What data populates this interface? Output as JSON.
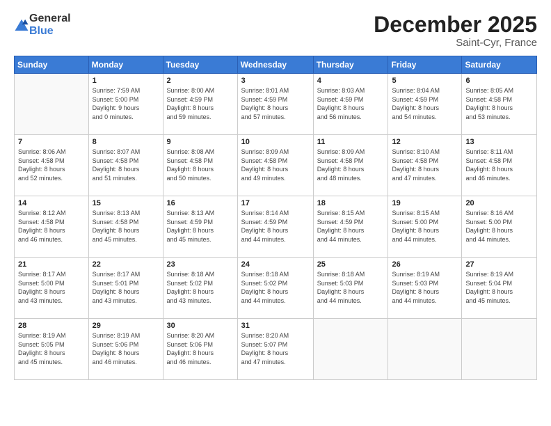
{
  "header": {
    "logo_general": "General",
    "logo_blue": "Blue",
    "title": "December 2025",
    "subtitle": "Saint-Cyr, France"
  },
  "calendar": {
    "days_of_week": [
      "Sunday",
      "Monday",
      "Tuesday",
      "Wednesday",
      "Thursday",
      "Friday",
      "Saturday"
    ],
    "weeks": [
      [
        {
          "day": "",
          "info": ""
        },
        {
          "day": "1",
          "info": "Sunrise: 7:59 AM\nSunset: 5:00 PM\nDaylight: 9 hours\nand 0 minutes."
        },
        {
          "day": "2",
          "info": "Sunrise: 8:00 AM\nSunset: 4:59 PM\nDaylight: 8 hours\nand 59 minutes."
        },
        {
          "day": "3",
          "info": "Sunrise: 8:01 AM\nSunset: 4:59 PM\nDaylight: 8 hours\nand 57 minutes."
        },
        {
          "day": "4",
          "info": "Sunrise: 8:03 AM\nSunset: 4:59 PM\nDaylight: 8 hours\nand 56 minutes."
        },
        {
          "day": "5",
          "info": "Sunrise: 8:04 AM\nSunset: 4:59 PM\nDaylight: 8 hours\nand 54 minutes."
        },
        {
          "day": "6",
          "info": "Sunrise: 8:05 AM\nSunset: 4:58 PM\nDaylight: 8 hours\nand 53 minutes."
        }
      ],
      [
        {
          "day": "7",
          "info": "Sunrise: 8:06 AM\nSunset: 4:58 PM\nDaylight: 8 hours\nand 52 minutes."
        },
        {
          "day": "8",
          "info": "Sunrise: 8:07 AM\nSunset: 4:58 PM\nDaylight: 8 hours\nand 51 minutes."
        },
        {
          "day": "9",
          "info": "Sunrise: 8:08 AM\nSunset: 4:58 PM\nDaylight: 8 hours\nand 50 minutes."
        },
        {
          "day": "10",
          "info": "Sunrise: 8:09 AM\nSunset: 4:58 PM\nDaylight: 8 hours\nand 49 minutes."
        },
        {
          "day": "11",
          "info": "Sunrise: 8:09 AM\nSunset: 4:58 PM\nDaylight: 8 hours\nand 48 minutes."
        },
        {
          "day": "12",
          "info": "Sunrise: 8:10 AM\nSunset: 4:58 PM\nDaylight: 8 hours\nand 47 minutes."
        },
        {
          "day": "13",
          "info": "Sunrise: 8:11 AM\nSunset: 4:58 PM\nDaylight: 8 hours\nand 46 minutes."
        }
      ],
      [
        {
          "day": "14",
          "info": "Sunrise: 8:12 AM\nSunset: 4:58 PM\nDaylight: 8 hours\nand 46 minutes."
        },
        {
          "day": "15",
          "info": "Sunrise: 8:13 AM\nSunset: 4:58 PM\nDaylight: 8 hours\nand 45 minutes."
        },
        {
          "day": "16",
          "info": "Sunrise: 8:13 AM\nSunset: 4:59 PM\nDaylight: 8 hours\nand 45 minutes."
        },
        {
          "day": "17",
          "info": "Sunrise: 8:14 AM\nSunset: 4:59 PM\nDaylight: 8 hours\nand 44 minutes."
        },
        {
          "day": "18",
          "info": "Sunrise: 8:15 AM\nSunset: 4:59 PM\nDaylight: 8 hours\nand 44 minutes."
        },
        {
          "day": "19",
          "info": "Sunrise: 8:15 AM\nSunset: 5:00 PM\nDaylight: 8 hours\nand 44 minutes."
        },
        {
          "day": "20",
          "info": "Sunrise: 8:16 AM\nSunset: 5:00 PM\nDaylight: 8 hours\nand 44 minutes."
        }
      ],
      [
        {
          "day": "21",
          "info": "Sunrise: 8:17 AM\nSunset: 5:00 PM\nDaylight: 8 hours\nand 43 minutes."
        },
        {
          "day": "22",
          "info": "Sunrise: 8:17 AM\nSunset: 5:01 PM\nDaylight: 8 hours\nand 43 minutes."
        },
        {
          "day": "23",
          "info": "Sunrise: 8:18 AM\nSunset: 5:02 PM\nDaylight: 8 hours\nand 43 minutes."
        },
        {
          "day": "24",
          "info": "Sunrise: 8:18 AM\nSunset: 5:02 PM\nDaylight: 8 hours\nand 44 minutes."
        },
        {
          "day": "25",
          "info": "Sunrise: 8:18 AM\nSunset: 5:03 PM\nDaylight: 8 hours\nand 44 minutes."
        },
        {
          "day": "26",
          "info": "Sunrise: 8:19 AM\nSunset: 5:03 PM\nDaylight: 8 hours\nand 44 minutes."
        },
        {
          "day": "27",
          "info": "Sunrise: 8:19 AM\nSunset: 5:04 PM\nDaylight: 8 hours\nand 45 minutes."
        }
      ],
      [
        {
          "day": "28",
          "info": "Sunrise: 8:19 AM\nSunset: 5:05 PM\nDaylight: 8 hours\nand 45 minutes."
        },
        {
          "day": "29",
          "info": "Sunrise: 8:19 AM\nSunset: 5:06 PM\nDaylight: 8 hours\nand 46 minutes."
        },
        {
          "day": "30",
          "info": "Sunrise: 8:20 AM\nSunset: 5:06 PM\nDaylight: 8 hours\nand 46 minutes."
        },
        {
          "day": "31",
          "info": "Sunrise: 8:20 AM\nSunset: 5:07 PM\nDaylight: 8 hours\nand 47 minutes."
        },
        {
          "day": "",
          "info": ""
        },
        {
          "day": "",
          "info": ""
        },
        {
          "day": "",
          "info": ""
        }
      ]
    ]
  }
}
